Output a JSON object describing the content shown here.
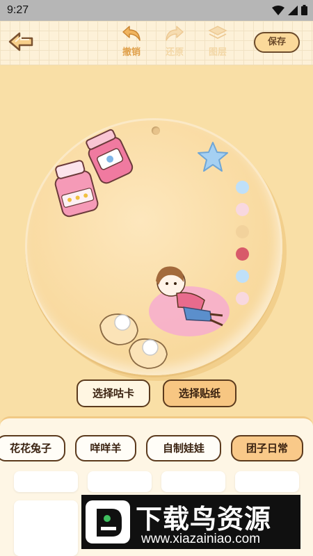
{
  "status_bar": {
    "time": "9:27"
  },
  "toolbar": {
    "undo_label": "撤销",
    "redo_label": "还原",
    "layer_label": "图层",
    "save_label": "保存"
  },
  "color_swatches": [
    "#bfe0f8",
    "#f8d8df",
    "#f2d29c",
    "#d85a6a",
    "#bfe0f8",
    "#f8d8df"
  ],
  "choose_buttons": {
    "guka": "选择咕卡",
    "tiezhi": "选择贴纸"
  },
  "tabs": [
    {
      "label": "花花兔子"
    },
    {
      "label": "咩咩羊"
    },
    {
      "label": "自制娃娃"
    },
    {
      "label": "团子日常",
      "selected": true
    }
  ],
  "colors": {
    "accent_orange": "#e0a04a",
    "button_fill": "#f7c682",
    "outline_brown": "#5b3a1d"
  },
  "watermark": {
    "title": "下载鸟资源",
    "url": "www.xiazainiao.com"
  }
}
